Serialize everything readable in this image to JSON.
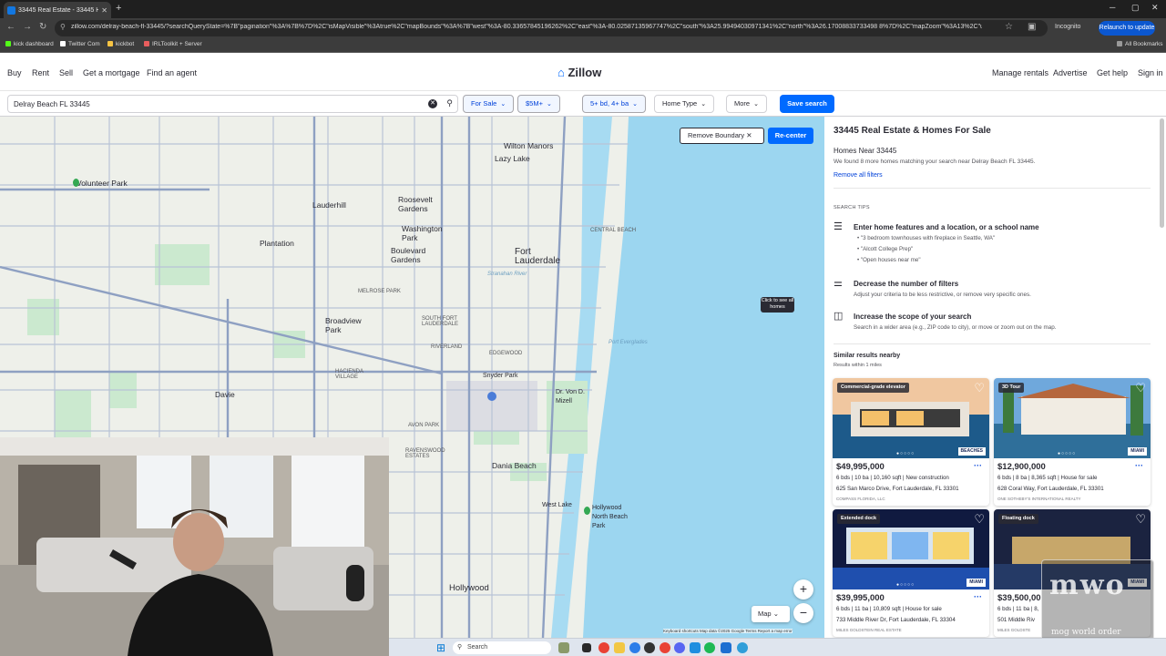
{
  "browser": {
    "tab_title": "33445 Real Estate - 33445 Hom",
    "url": "zillow.com/delray-beach-fl-33445/?searchQueryState=%7B\"pagination\"%3A%7B%7D%2C\"isMapVisible\"%3Atrue%2C\"mapBounds\"%3A%7B\"west\"%3A-80.33657845196262%2C\"east\"%3A-80.02587135967747%2C\"south\"%3A25.99494030971341%2C\"north\"%3A26.17008833733498 8%7D%2C\"mapZoom\"%3A13%2C\"usersSe...",
    "incognito_label": "Incognito",
    "relaunch_label": "Relaunch to update",
    "bookmarks": [
      "kick dashboard",
      "Twitter Com",
      "kickbot",
      "IRLToolkit + Server"
    ],
    "all_bookmarks": "All Bookmarks"
  },
  "header": {
    "left_nav": [
      "Buy",
      "Rent",
      "Sell",
      "Get a mortgage",
      "Find an agent"
    ],
    "logo": "Zillow",
    "right_nav": [
      "Manage rentals",
      "Advertise",
      "Get help",
      "Sign in"
    ]
  },
  "filters": {
    "search_value": "Delray Beach FL 33445",
    "buttons": [
      "For Sale",
      "$5M+",
      "5+ bd, 4+ ba",
      "Home Type",
      "More"
    ],
    "save_label": "Save search"
  },
  "map": {
    "remove_boundary": "Remove Boundary",
    "recenter": "Re-center",
    "tooltip": "Click to see all homes",
    "map_type": "Map",
    "attribution": "Keyboard shortcuts   Map data ©2025 Google   Terms   Report a map error",
    "labels": {
      "volunteer_park": "Volunteer Park",
      "wilton_manors": "Wilton Manors",
      "lazy_lake": "Lazy Lake",
      "lauderhill": "Lauderhill",
      "roosevelt_gardens": "Roosevelt Gardens",
      "washington_park": "Washington Park",
      "plantation": "Plantation",
      "boulevard_gardens": "Boulevard Gardens",
      "fort_lauderdale": "Fort Lauderdale",
      "central_beach": "CENTRAL BEACH",
      "melrose_park": "MELROSE PARK",
      "broadview_park": "Broadview Park",
      "south_fort_lauderdale": "SOUTH FORT LAUDERDALE",
      "edgewood": "EDGEWOOD",
      "riverland": "RIVERLAND",
      "hacienda_village": "HACIENDA VILLAGE",
      "snyder_park": "Snyder Park",
      "davie": "Davie",
      "dr_von_d_mizell": "Dr. Von D. Mizell",
      "avon_park": "AVON PARK",
      "ravenswood_estates": "RAVENSWOOD ESTATES",
      "dania_beach": "Dania Beach",
      "hollywood": "Hollywood",
      "west_lake": "West Lake",
      "hollywood_north_beach": "Hollywood North Beach Park",
      "port_everglades": "Port Everglades",
      "stranahan_river": "Stranahan River"
    }
  },
  "panel": {
    "title": "33445 Real Estate & Homes For Sale",
    "homes_near": "Homes Near 33445",
    "found_text": "We found 8 more homes matching your search near Delray Beach FL 33445.",
    "remove_filters": "Remove all filters",
    "search_tips_label": "SEARCH TIPS",
    "tips": [
      {
        "icon": "list-icon",
        "head": "Enter home features and a location, or a school name",
        "bullets": [
          "\"3 bedroom townhouses with fireplace in Seattle, WA\"",
          "\"Alcott College Prep\"",
          "\"Open houses near me\""
        ]
      },
      {
        "icon": "sliders-icon",
        "head": "Decrease the number of filters",
        "line": "Adjust your criteria to be less restrictive, or remove very specific ones."
      },
      {
        "icon": "map-icon",
        "head": "Increase the scope of your search",
        "line": "Search in a wider area (e.g., ZIP code to city), or move or zoom out on the map."
      }
    ],
    "similar_label": "Similar results nearby",
    "within_label": "Results within 1 miles",
    "listings": [
      {
        "badge": "Commercial-grade elevator",
        "price": "$49,995,000",
        "facts": "6 bds | 10 ba | 10,160 sqft | New construction",
        "address": "625 San Marco Drive, Fort Lauderdale, FL 33301",
        "broker": "COMPASS FLORIDA, LLC",
        "logo": "BEACHES"
      },
      {
        "badge": "3D Tour",
        "price": "$12,900,000",
        "facts": "6 bds | 8 ba | 8,365 sqft | House for sale",
        "address": "628 Coral Way, Fort Lauderdale, FL 33301",
        "broker": "ONE SOTHEBY'S INTERNATIONAL REALTY",
        "logo": "MIAMI"
      },
      {
        "badge": "Extended dock",
        "price": "$39,995,000",
        "facts": "6 bds | 11 ba | 10,809 sqft | House for sale",
        "address": "733 Middle River Dr, Fort Lauderdale, FL 33304",
        "broker": "MILES GOLDSTEIN REAL ESTATE",
        "logo": "MIAMI"
      },
      {
        "badge": "Floating dock",
        "price": "$39,500,00",
        "facts": "6 bds | 11 ba | 8,",
        "address": "501 Middle Riv",
        "broker": "MILES GOLDSTE",
        "logo": "MIAMI"
      }
    ]
  },
  "taskbar": {
    "search_label": "Search"
  },
  "watermark": {
    "line1": "mwo",
    "line2": "mog world order"
  },
  "colors": {
    "brand_blue": "#006aff",
    "link_blue": "#0041d9",
    "text_dark": "#2a2a33",
    "water": "#9cd6f0"
  }
}
